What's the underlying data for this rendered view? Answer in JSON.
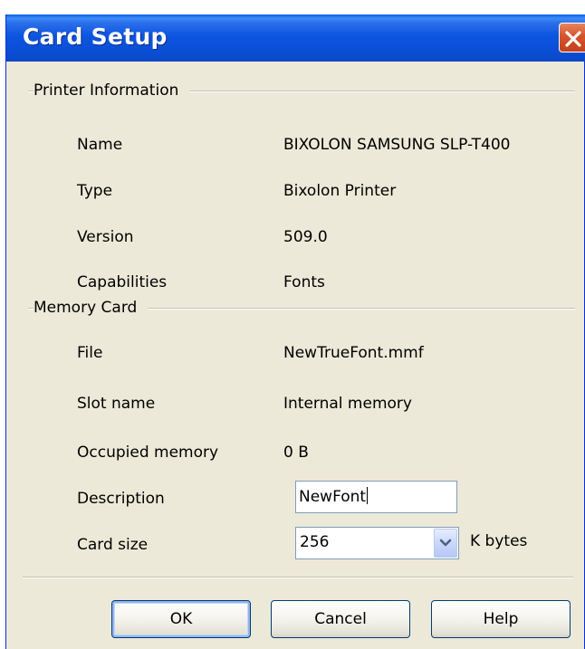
{
  "window": {
    "title": "Card Setup"
  },
  "printer_info": {
    "group_title": "Printer Information",
    "rows": [
      {
        "label": "Name",
        "value": "BIXOLON SAMSUNG SLP-T400"
      },
      {
        "label": "Type",
        "value": "Bixolon Printer"
      },
      {
        "label": "Version",
        "value": "509.0"
      },
      {
        "label": "Capabilities",
        "value": "Fonts"
      }
    ]
  },
  "memory_card": {
    "group_title": "Memory Card",
    "rows": [
      {
        "label": "File",
        "value": "NewTrueFont.mmf"
      },
      {
        "label": "Slot name",
        "value": "Internal memory"
      },
      {
        "label": "Occupied memory",
        "value": "0 B"
      }
    ],
    "description_label": "Description",
    "description_value": "NewFont",
    "card_size_label": "Card size",
    "card_size_value": "256",
    "card_size_unit": "K bytes"
  },
  "buttons": {
    "ok": "OK",
    "cancel": "Cancel",
    "help": "Help"
  },
  "colors": {
    "titlebar": "#0a4fd6",
    "dialog_bg": "#ece9d8",
    "close_button": "#d6532b",
    "button_border": "#003c74"
  },
  "icons": {
    "close": "close-icon",
    "dropdown": "chevron-down-icon"
  }
}
